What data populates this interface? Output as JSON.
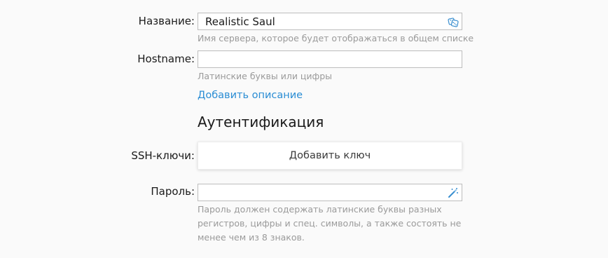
{
  "form": {
    "name": {
      "label": "Название:",
      "value": "Realistic Saul",
      "hint": "Имя сервера, которое будет отображаться в общем списке",
      "icon": "dice-icon"
    },
    "hostname": {
      "label": "Hostname:",
      "value": "",
      "hint": "Латинские буквы или цифры"
    },
    "add_description_link": "Добавить описание",
    "auth": {
      "heading": "Аутентификация",
      "ssh": {
        "label": "SSH-ключи:",
        "button": "Добавить ключ"
      },
      "password": {
        "label": "Пароль:",
        "value": "",
        "icon": "magic-wand-icon",
        "hint": "Пароль должен содержать латинские буквы разных регистров, цифры и спец. символы, а также состоять не менее чем из 8 знаков."
      }
    }
  },
  "colors": {
    "link": "#2a8dd4",
    "icon": "#3a8fd0",
    "hint": "#9a9a9a",
    "background": "#fafafa"
  }
}
